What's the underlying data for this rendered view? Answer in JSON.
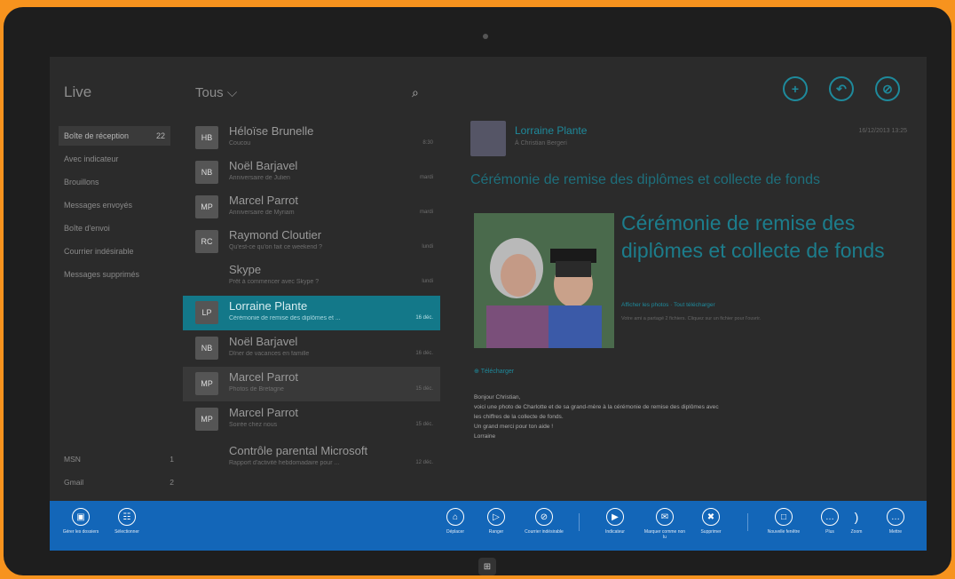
{
  "folders": {
    "account_title": "Live",
    "items": [
      {
        "label": "Boîte de réception",
        "count": "22"
      },
      {
        "label": "Avec indicateur",
        "count": ""
      },
      {
        "label": "Brouillons",
        "count": ""
      },
      {
        "label": "Messages envoyés",
        "count": ""
      },
      {
        "label": "Boîte d'envoi",
        "count": ""
      },
      {
        "label": "Courrier indésirable",
        "count": ""
      },
      {
        "label": "Messages supprimés",
        "count": ""
      }
    ],
    "accounts": [
      {
        "label": "MSN",
        "count": "1"
      },
      {
        "label": "Gmail",
        "count": "2"
      }
    ]
  },
  "list": {
    "filter": "Tous",
    "messages": [
      {
        "from": "Héloïse Brunelle",
        "subject": "Coucou",
        "time": "8:30"
      },
      {
        "from": "Noël Barjavel",
        "subject": "Anniversaire de Julien",
        "time": "mardi"
      },
      {
        "from": "Marcel Parrot",
        "subject": "Anniversaire de Myriam",
        "time": "mardi"
      },
      {
        "from": "Raymond Cloutier",
        "subject": "Qu'est-ce qu'on fait ce weekend ?",
        "time": "lundi"
      },
      {
        "from": "Skype",
        "subject": "Prêt à commencer avec Skype ?",
        "time": "lundi"
      },
      {
        "from": "Lorraine Plante",
        "subject": "Cérémonie de remise des diplômes et ...",
        "time": "16 déc."
      },
      {
        "from": "Noël Barjavel",
        "subject": "Dîner de vacances en famille",
        "time": "16 déc."
      },
      {
        "from": "Marcel Parrot",
        "subject": "Photos de Bretagne",
        "time": "15 déc."
      },
      {
        "from": "Marcel Parrot",
        "subject": "Soirée chez nous",
        "time": "15 déc."
      },
      {
        "from": "Contrôle parental Microsoft",
        "subject": "Rapport d'activité hebdomadaire pour ...",
        "time": "12 déc."
      }
    ]
  },
  "reading": {
    "sender": "Lorraine Plante",
    "to": "À Christian Bergeri",
    "date": "16/12/2013 13:25",
    "subject": "Cérémonie de remise des diplômes et collecte de fonds",
    "card_title": "Cérémonie de remise des diplômes et collecte de fonds",
    "card_link": "Afficher les photos · Tout télécharger",
    "card_meta": "Votre ami a partagé 2 fichiers. Cliquez sur un fichier pour l'ouvrir.",
    "attachment": "Télécharger",
    "body": [
      "Bonjour Christian,",
      "voici une photo de Charlotte et de sa grand-mère à la cérémonie de remise des diplômes avec",
      "les chiffres de la collecte de fonds.",
      "Un grand merci pour ton aide !",
      "Lorraine"
    ]
  },
  "appbar": {
    "left": [
      {
        "label": "Gérer les dossiers",
        "icon": "folder-icon"
      },
      {
        "label": "Sélectionner",
        "icon": "select-icon"
      }
    ],
    "middle": [
      {
        "label": "Déplacer",
        "icon": "move-icon"
      },
      {
        "label": "Ranger",
        "icon": "sweep-icon"
      },
      {
        "label": "Courrier indésirable",
        "icon": "junk-icon"
      }
    ],
    "right_group": [
      {
        "label": "Indicateur",
        "icon": "flag-icon"
      },
      {
        "label": "Marquer comme non lu",
        "icon": "mark-unread-icon"
      },
      {
        "label": "Supprimer",
        "icon": "delete-icon"
      }
    ],
    "far": [
      {
        "label": "Nouvelle fenêtre",
        "icon": "new-window-icon"
      },
      {
        "label": "Plus",
        "icon": "more-icon"
      },
      {
        "label": "Zoom",
        "icon": "zoom-icon"
      },
      {
        "label": "Mettre",
        "icon": "ellipsis-icon"
      }
    ]
  },
  "colors": {
    "accent": "#1e8a9c",
    "appbar": "#1366b8",
    "bezel": "#f7931e"
  }
}
